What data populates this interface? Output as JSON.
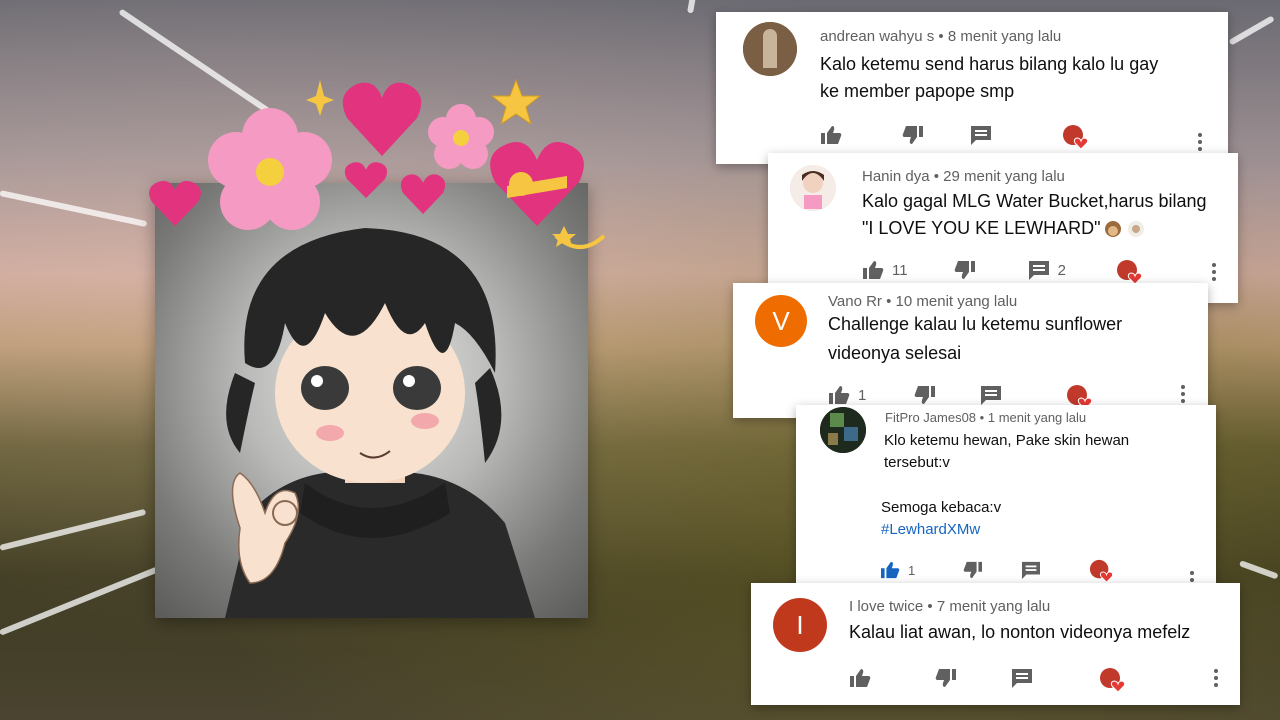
{
  "comments": [
    {
      "author": "andrean wahyu s",
      "time": "8 menit yang lalu",
      "lines": [
        "Kalo ketemu send harus bilang kalo lu gay",
        "ke member papope smp"
      ],
      "likes": "",
      "replies": ""
    },
    {
      "author": "Hanin dya",
      "time": "29 menit yang lalu",
      "lines": [
        "Kalo gagal MLG Water Bucket,harus bilang",
        "\"I LOVE YOU KE  LEWHARD\""
      ],
      "likes": "11",
      "replies": "2"
    },
    {
      "author": "Vano Rr",
      "avatar_letter": "V",
      "time": "10 menit yang lalu",
      "lines": [
        "Challenge kalau lu ketemu sunflower",
        "videonya selesai"
      ],
      "likes": "1",
      "replies": ""
    },
    {
      "author": "FitPro James08",
      "time": "1 menit yang lalu",
      "lines": [
        "Klo ketemu hewan, Pake skin hewan",
        "tersebut:v",
        "",
        "Semoga kebaca:v"
      ],
      "hashtag": "#LewhardXMw",
      "likes": "1",
      "replies": ""
    },
    {
      "author": "I love twice",
      "avatar_letter": "I",
      "time": "7 menit yang lalu",
      "lines": [
        "Kalau liat awan, lo nonton videonya mefelz"
      ],
      "likes": "",
      "replies": ""
    }
  ],
  "separator": "•",
  "colors": {
    "avatar_v": "#ef6c00",
    "avatar_i": "#c0391d",
    "link": "#1565c0",
    "meta": "#606060",
    "text": "#0f0f0f",
    "creator_heart": "#e53935"
  },
  "icons": [
    "like-icon",
    "dislike-icon",
    "reply-icon",
    "creator-heart-icon",
    "more-icon"
  ]
}
